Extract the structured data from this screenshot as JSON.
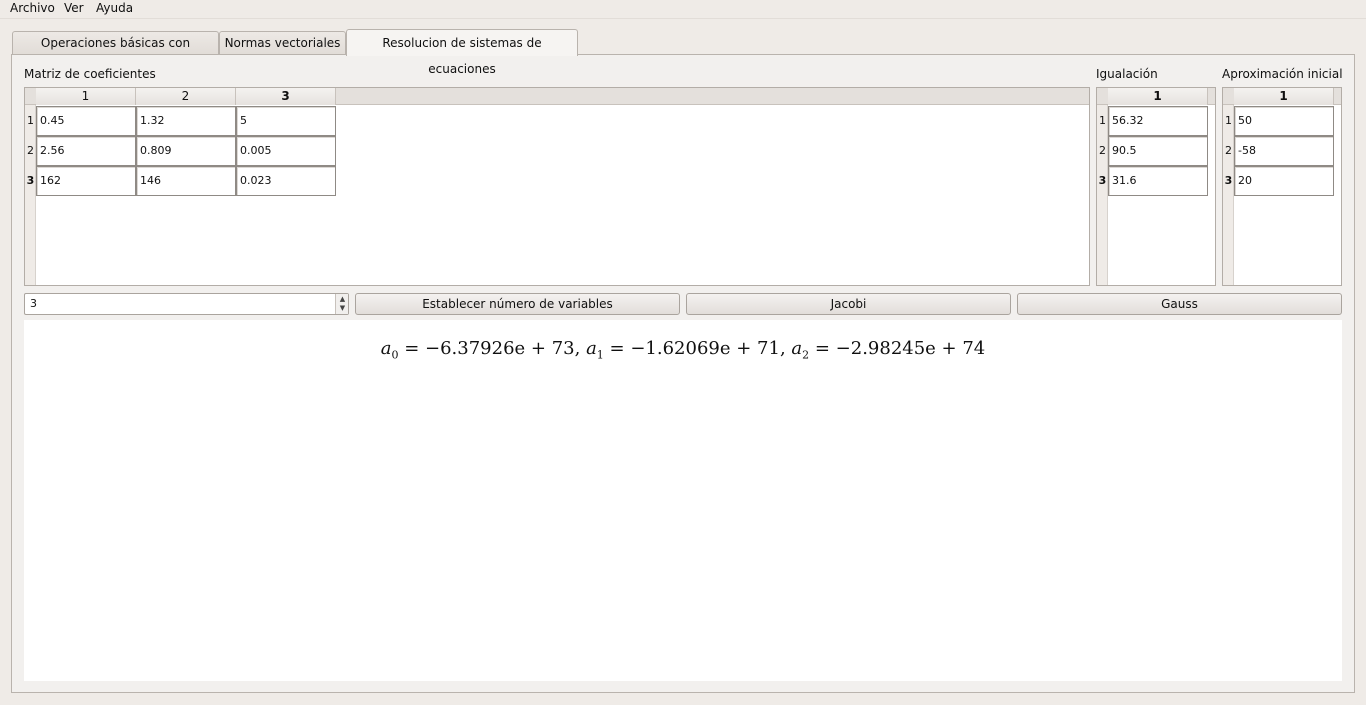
{
  "menu": [
    "Archivo",
    "Ver",
    "Ayuda"
  ],
  "tabs": [
    {
      "label": "Operaciones básicas con matrices",
      "active": false
    },
    {
      "label": "Normas vectoriales",
      "active": false
    },
    {
      "label": "Resolucion de sistemas de ecuaciones",
      "active": true
    }
  ],
  "coef": {
    "label": "Matriz de coeficientes",
    "headers": [
      "1",
      "2",
      "3"
    ],
    "rows": [
      {
        "label": "1",
        "cells": [
          "0.45",
          "1.32",
          "5"
        ]
      },
      {
        "label": "2",
        "cells": [
          "2.56",
          "0.809",
          "0.005"
        ]
      },
      {
        "label": "3",
        "cells": [
          "162",
          "146",
          "0.023"
        ]
      }
    ]
  },
  "igualacion": {
    "label": "Igualación",
    "header": "1",
    "rows": [
      {
        "label": "1",
        "value": "56.32"
      },
      {
        "label": "2",
        "value": "90.5"
      },
      {
        "label": "3",
        "value": "31.6"
      }
    ]
  },
  "aprox": {
    "label": "Aproximación inicial",
    "header": "1",
    "rows": [
      {
        "label": "1",
        "value": "50"
      },
      {
        "label": "2",
        "value": "-58"
      },
      {
        "label": "3",
        "value": "20"
      }
    ]
  },
  "controls": {
    "num_vars": "3",
    "set_vars_label": "Establecer número de variables",
    "jacobi_label": "Jacobi",
    "gauss_label": "Gauss"
  },
  "result": {
    "terms": [
      {
        "var": "a",
        "sub": "0",
        "value": "−6.37926e + 73"
      },
      {
        "var": "a",
        "sub": "1",
        "value": "−1.62069e + 71"
      },
      {
        "var": "a",
        "sub": "2",
        "value": "−2.98245e + 74"
      }
    ]
  },
  "colors": {
    "window_bg": "#efebe7",
    "panel_border": "#b9b3ad",
    "cell_border": "#8f8a85"
  }
}
